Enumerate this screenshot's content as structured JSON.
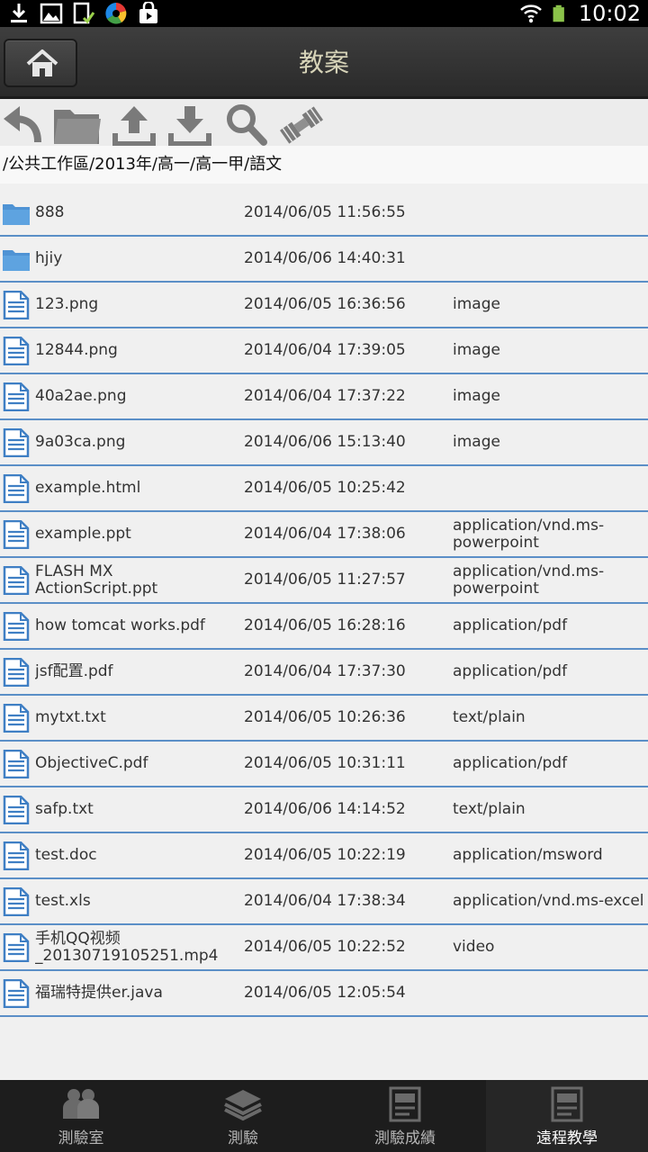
{
  "status_bar": {
    "time": "10:02",
    "left_icons": [
      "download-icon",
      "image-icon",
      "file-check-icon",
      "app-logo-icon",
      "store-icon"
    ],
    "right_icons": [
      "wifi-icon",
      "battery-icon"
    ]
  },
  "action_bar": {
    "title": "教案",
    "home_icon": "home-icon",
    "title_color": "#d6d3b8"
  },
  "toolbar": {
    "icons": [
      "back-icon",
      "folder-icon",
      "upload-icon",
      "download-icon",
      "search-icon",
      "satellite-icon"
    ]
  },
  "breadcrumb": "/公共工作區/2013年/高一/高一甲/語文",
  "files": [
    {
      "name": "888",
      "date": "2014/06/05 11:56:55",
      "type": "",
      "kind": "folder"
    },
    {
      "name": "hjiy",
      "date": "2014/06/06 14:40:31",
      "type": "",
      "kind": "folder"
    },
    {
      "name": "123.png",
      "date": "2014/06/05 16:36:56",
      "type": "image",
      "kind": "file"
    },
    {
      "name": "12844.png",
      "date": "2014/06/04 17:39:05",
      "type": "image",
      "kind": "file"
    },
    {
      "name": "40a2ae.png",
      "date": "2014/06/04 17:37:22",
      "type": "image",
      "kind": "file"
    },
    {
      "name": "9a03ca.png",
      "date": "2014/06/06 15:13:40",
      "type": "image",
      "kind": "file"
    },
    {
      "name": "example.html",
      "date": "2014/06/05 10:25:42",
      "type": "",
      "kind": "file"
    },
    {
      "name": "example.ppt",
      "date": "2014/06/04 17:38:06",
      "type": "application/vnd.ms-powerpoint",
      "kind": "file"
    },
    {
      "name": "FLASH MX ActionScript.ppt",
      "date": "2014/06/05 11:27:57",
      "type": "application/vnd.ms-powerpoint",
      "kind": "file"
    },
    {
      "name": "how tomcat works.pdf",
      "date": "2014/06/05 16:28:16",
      "type": "application/pdf",
      "kind": "file"
    },
    {
      "name": "jsf配置.pdf",
      "date": "2014/06/04 17:37:30",
      "type": "application/pdf",
      "kind": "file"
    },
    {
      "name": "mytxt.txt",
      "date": "2014/06/05 10:26:36",
      "type": "text/plain",
      "kind": "file"
    },
    {
      "name": "ObjectiveC.pdf",
      "date": "2014/06/05 10:31:11",
      "type": "application/pdf",
      "kind": "file"
    },
    {
      "name": "safp.txt",
      "date": "2014/06/06 14:14:52",
      "type": "text/plain",
      "kind": "file"
    },
    {
      "name": "test.doc",
      "date": "2014/06/05 10:22:19",
      "type": "application/msword",
      "kind": "file"
    },
    {
      "name": "test.xls",
      "date": "2014/06/04 17:38:34",
      "type": "application/vnd.ms-excel",
      "kind": "file"
    },
    {
      "name": "手机QQ视频_20130719105251.mp4",
      "date": "2014/06/05 10:22:52",
      "type": "video",
      "kind": "file"
    },
    {
      "name": "福瑞特提供er.java",
      "date": "2014/06/05 12:05:54",
      "type": "",
      "kind": "file"
    }
  ],
  "bottom_nav": [
    {
      "label": "測驗室",
      "icon": "users-icon",
      "active": false
    },
    {
      "label": "測驗",
      "icon": "layers-icon",
      "active": false
    },
    {
      "label": "測驗成績",
      "icon": "document-icon",
      "active": false
    },
    {
      "label": "遠程教學",
      "icon": "document-icon",
      "active": true
    }
  ],
  "colors": {
    "divider": "#5b8fc7",
    "folder": "#4f93d4",
    "file_icon": "#3f7fc4",
    "toolbar_icon": "#7a7a7a"
  }
}
